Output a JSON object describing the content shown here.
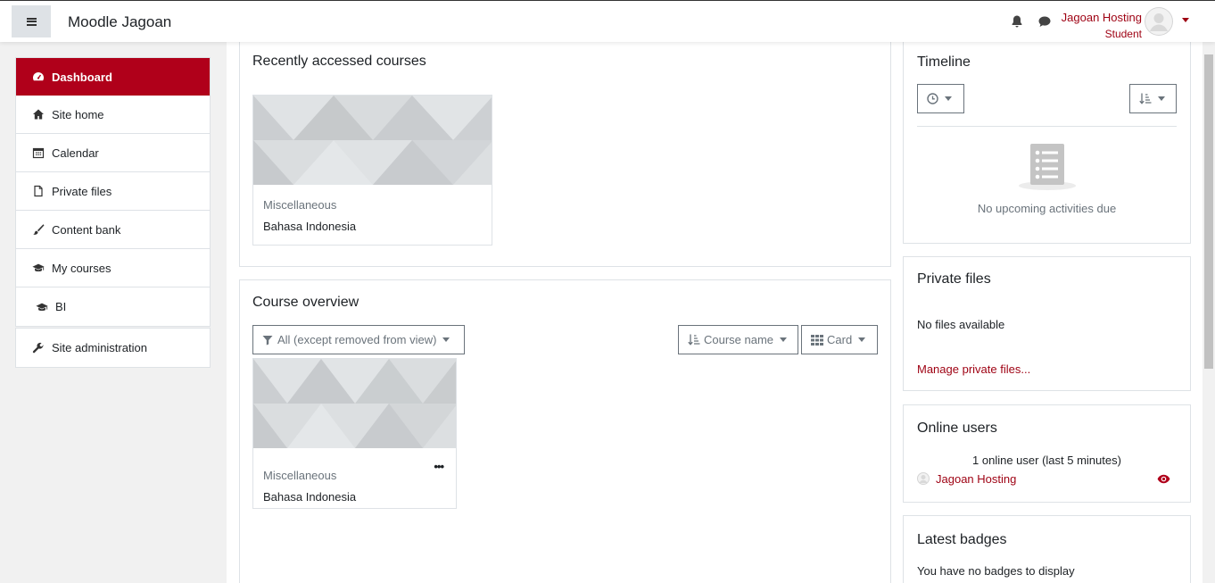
{
  "navbar": {
    "brand": "Moodle Jagoan",
    "user_name": "Jagoan Hosting",
    "user_role": "Student"
  },
  "colors": {
    "accent": "#b0001a",
    "link": "#9e0012"
  },
  "drawer": {
    "items": [
      {
        "label": "Dashboard",
        "icon": "dashboard-icon",
        "active": true
      },
      {
        "label": "Site home",
        "icon": "home-icon"
      },
      {
        "label": "Calendar",
        "icon": "calendar-icon"
      },
      {
        "label": "Private files",
        "icon": "file-icon"
      },
      {
        "label": "Content bank",
        "icon": "paintbrush-icon"
      },
      {
        "label": "My courses",
        "icon": "graduation-cap-icon"
      },
      {
        "label": "BI",
        "icon": "graduation-cap-icon"
      }
    ],
    "admin": {
      "label": "Site administration",
      "icon": "wrench-icon"
    }
  },
  "recent": {
    "title": "Recently accessed courses",
    "course": {
      "category": "Miscellaneous",
      "name": "Bahasa Indonesia"
    }
  },
  "overview": {
    "title": "Course overview",
    "filter_label": "All (except removed from view)",
    "sort_label": "Course name",
    "view_label": "Card",
    "course": {
      "category": "Miscellaneous",
      "name": "Bahasa Indonesia",
      "menu": "•••"
    }
  },
  "timeline": {
    "title": "Timeline",
    "empty": "No upcoming activities due"
  },
  "private_files": {
    "title": "Private files",
    "empty": "No files available",
    "manage_link": "Manage private files..."
  },
  "online_users": {
    "title": "Online users",
    "summary": "1 online user (last 5 minutes)",
    "users": [
      {
        "name": "Jagoan Hosting"
      }
    ]
  },
  "badges": {
    "title": "Latest badges",
    "empty": "You have no badges to display"
  }
}
